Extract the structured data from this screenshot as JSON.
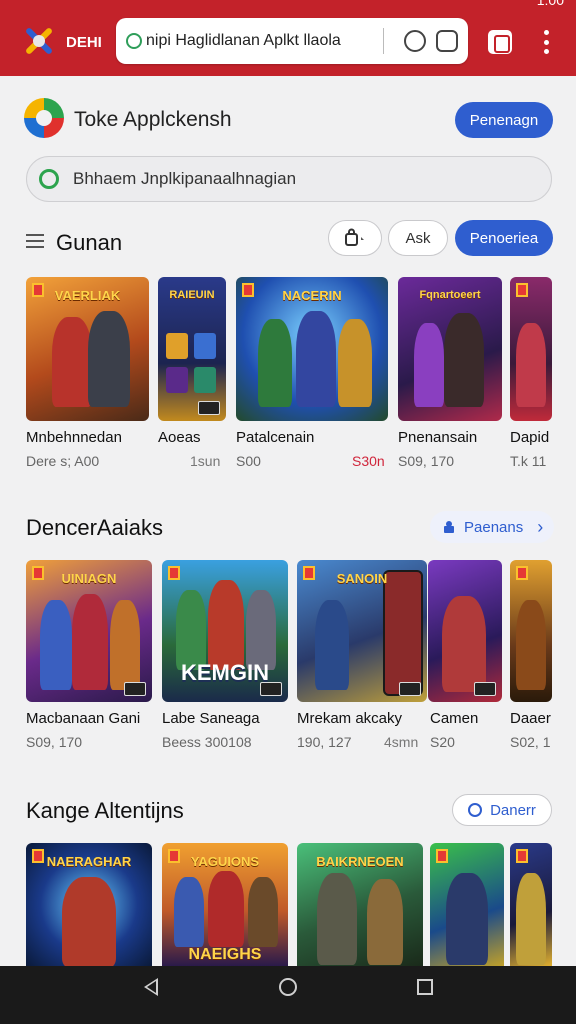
{
  "browser": {
    "app_label": "DEHI",
    "url_text": "nipi Haglidlanan Aplkt llaola",
    "status_text": "1:00"
  },
  "store": {
    "title": "Toke Applckensh",
    "top_button": "Penenagn",
    "search_placeholder": "Bhhaem Jnplkipanaalhnagian"
  },
  "section1": {
    "title": "Gunan",
    "ask_label": "Ask",
    "primary_button": "Penoeriea",
    "cards": [
      {
        "banner": "VAERLIAK",
        "title": "Mnbehnnedan",
        "meta": "Dere s; A00",
        "price": "",
        "price_red": false
      },
      {
        "banner": "RAIEUIN",
        "title": "Aoeas",
        "meta": "",
        "price": "1sun",
        "price_red": false
      },
      {
        "banner": "NACERIN",
        "title": "Patalcenain",
        "meta": "S00",
        "price": "S30n",
        "price_red": true
      },
      {
        "banner": "Fqnartoeert",
        "title": "Pnenansain",
        "meta": "S09, 170",
        "price": "",
        "price_red": false
      },
      {
        "banner": "",
        "title": "Dapid",
        "meta": "T.k 11",
        "price": "",
        "price_red": false
      }
    ]
  },
  "section2": {
    "title": "DencerAaiaks",
    "link_label": "Paenans",
    "cards": [
      {
        "banner": "UINIAGN",
        "title": "Macbanaan Gani",
        "meta": "S09, 170",
        "price": "",
        "big": ""
      },
      {
        "banner": "",
        "title": "Labe Saneaga",
        "meta": "Beess 300108",
        "price": "",
        "big": "KEMGIN"
      },
      {
        "banner": "SANOIN",
        "title": "Mrekam akcaky",
        "meta": "190, 127",
        "price": "4smn",
        "big": ""
      },
      {
        "banner": "",
        "title": "Camen",
        "meta": "S20",
        "price": "",
        "big": ""
      },
      {
        "banner": "",
        "title": "Daaer",
        "meta": "S02, 1",
        "price": "",
        "big": ""
      }
    ]
  },
  "section3": {
    "title": "Kange Altentijns",
    "button_label": "Danerr",
    "cards": [
      {
        "banner": "NAERAGHAR",
        "big": ""
      },
      {
        "banner": "YAGUIONS",
        "big": "NAEIGHS"
      },
      {
        "banner": "BAIKRNEOEN",
        "big": ""
      },
      {
        "banner": "",
        "big": ""
      },
      {
        "banner": "",
        "big": ""
      }
    ]
  },
  "colors": {
    "topbar": "#c3222a",
    "accent_blue": "#2f5ecf",
    "price_red": "#d0253b"
  },
  "icons": {
    "app_logo": "tools-icon",
    "url_lock": "globe-icon",
    "url_reload": "clock-icon",
    "url_profile": "account-icon",
    "tabs": "tab-switcher-icon",
    "menu": "kebab-icon",
    "ask_bag": "bag-icon",
    "section2_link": "lock-icon",
    "section3_button": "circle-e-icon",
    "nav_back": "back-icon",
    "nav_home": "home-icon",
    "nav_recent": "recent-icon"
  }
}
